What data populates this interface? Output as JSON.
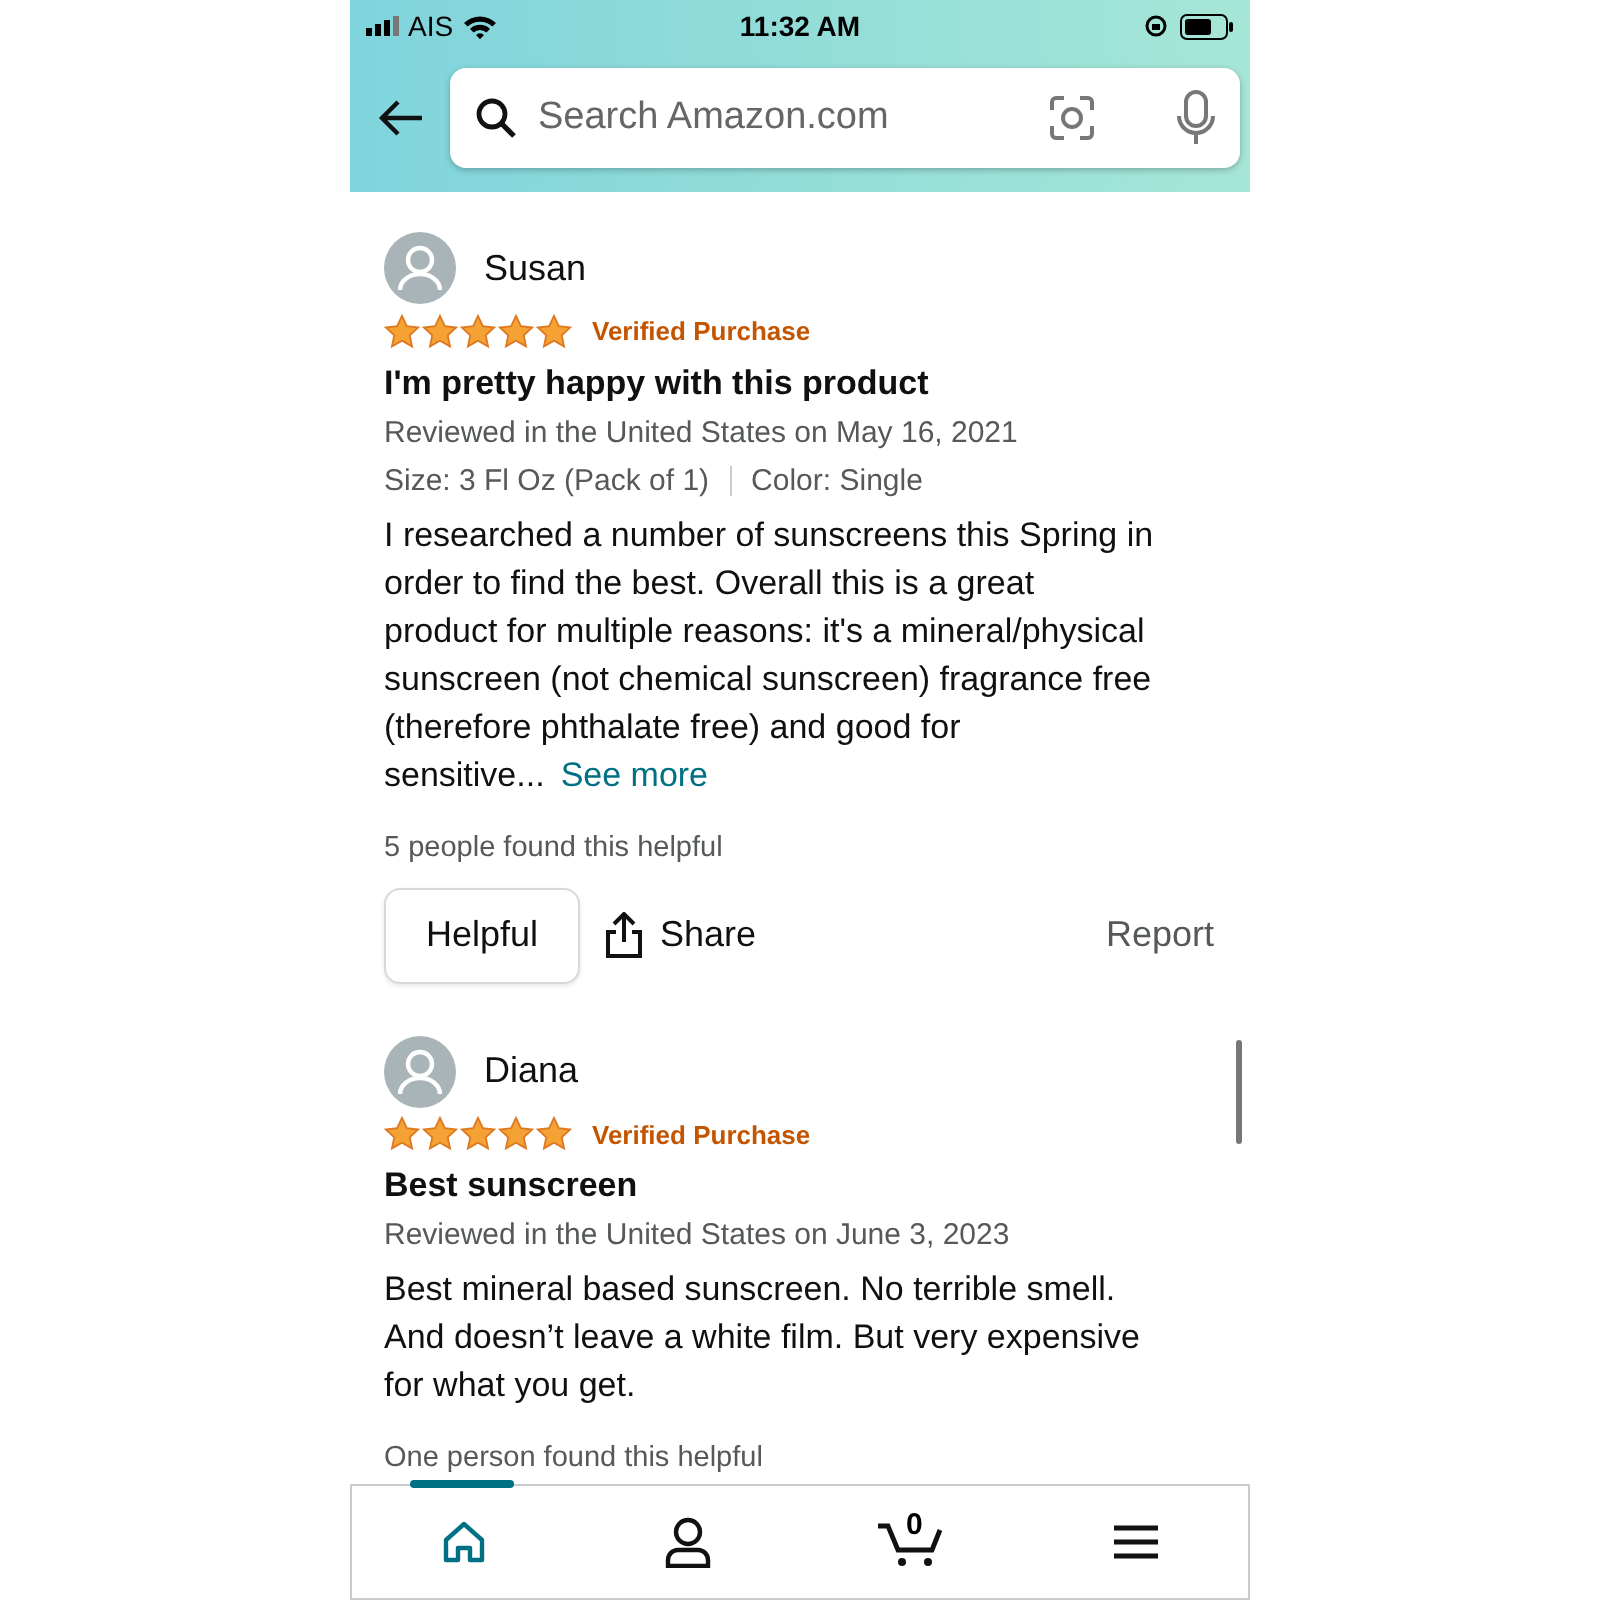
{
  "status_bar": {
    "carrier": "AIS",
    "time": "11:32 AM"
  },
  "search": {
    "placeholder": "Search Amazon.com"
  },
  "reviews": [
    {
      "author": "Susan",
      "stars": 5,
      "verified": "Verified Purchase",
      "title": "I'm pretty happy with this product",
      "date": "Reviewed in the United States on May 16, 2021",
      "details": [
        "Size: 3 Fl Oz (Pack of 1)",
        "Color: Single"
      ],
      "body": "I researched a number of sunscreens this Spring in order to find the best. Overall this is a great product for multiple reasons: it's a mineral/physical sunscreen (not chemical sunscreen) fragrance free (therefore phthalate free) and good for sensitive...",
      "see_more": "See more",
      "helpful_count": "5 people found this helpful",
      "helpful_button": "Helpful",
      "share": "Share",
      "report": "Report"
    },
    {
      "author": "Diana",
      "stars": 5,
      "verified": "Verified Purchase",
      "title": "Best sunscreen",
      "date": "Reviewed in the United States on June 3, 2023",
      "body": "Best mineral based sunscreen. No terrible smell. And doesn’t leave a white film. But very expensive for what you get.",
      "helpful_count": "One person found this helpful"
    }
  ],
  "nav": [
    {
      "kind": "home",
      "selected": true
    },
    {
      "kind": "account",
      "selected": false
    },
    {
      "kind": "cart",
      "selected": false,
      "count": "0"
    },
    {
      "kind": "menu",
      "selected": false
    }
  ]
}
